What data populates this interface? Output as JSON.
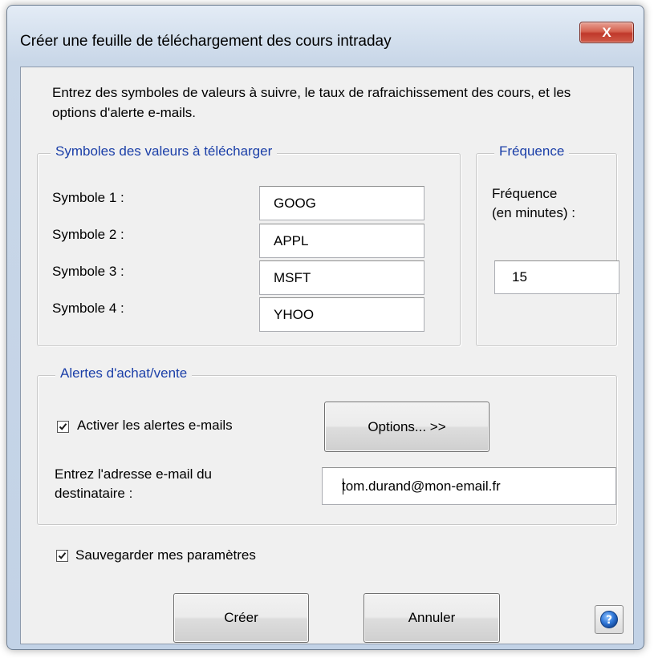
{
  "window": {
    "title": "Créer une feuille de téléchargement des cours intraday",
    "close_label": "X"
  },
  "intro": "Entrez des symboles de valeurs à suivre, le taux de rafraichissement des cours, et les options d'alerte e-mails.",
  "symbols_group": {
    "title": "Symboles des valeurs à télécharger",
    "rows": [
      {
        "label": "Symbole 1 :",
        "value": "GOOG"
      },
      {
        "label": "Symbole 2 :",
        "value": "APPL"
      },
      {
        "label": "Symbole 3 :",
        "value": "MSFT"
      },
      {
        "label": "Symbole 4 :",
        "value": "YHOO"
      }
    ]
  },
  "frequency_group": {
    "title": "Fréquence",
    "label_line1": "Fréquence",
    "label_line2": "(en minutes) :",
    "value": "15"
  },
  "alerts_group": {
    "title": "Alertes d'achat/vente",
    "enable_label": "Activer les alertes e-mails",
    "enable_checked": true,
    "options_button": "Options... >>",
    "email_label_line1": "Entrez l'adresse e-mail du",
    "email_label_line2": "destinataire :",
    "email_value": "tom.durand@mon-email.fr"
  },
  "save_settings": {
    "label": "Sauvegarder mes paramètres",
    "checked": true
  },
  "buttons": {
    "create": "Créer",
    "cancel": "Annuler"
  },
  "icons": {
    "help": "help-icon",
    "close": "close-icon"
  }
}
